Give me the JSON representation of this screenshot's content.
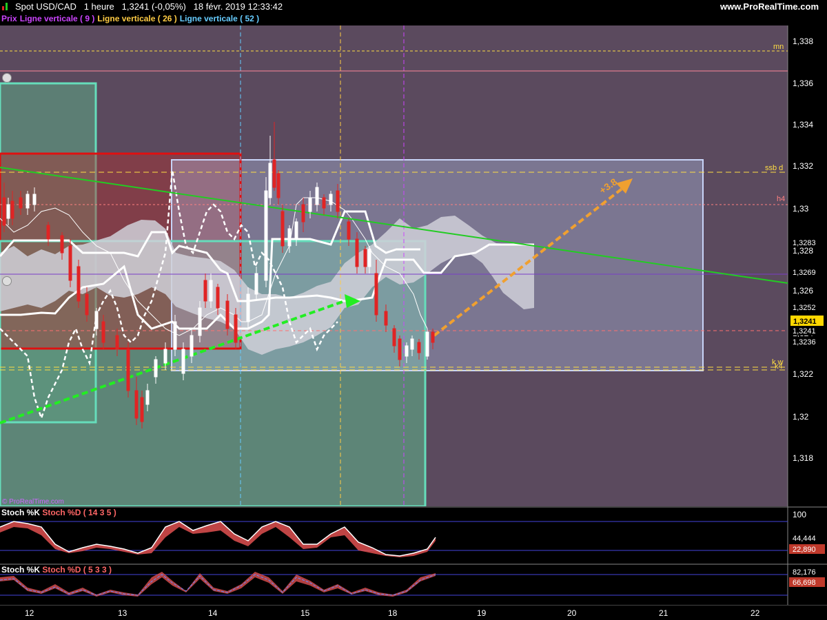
{
  "header": {
    "title": "Spot USD/CAD   1 heure   1,3241 (-0,05%)   18 févr. 2019 12:33:42",
    "site": "www.ProRealTime.com"
  },
  "legend": {
    "prix": "Prix",
    "lv9": "Ligne verticale ( 9 )",
    "lv26": "Ligne verticale ( 26 )",
    "lv52": "Ligne verticale ( 52 )"
  },
  "copyright": "© ProRealTime.com",
  "price_axis": {
    "ticks": [
      "1,338",
      "1,336",
      "1,334",
      "1,332",
      "1,33",
      "1,328",
      "1,326",
      "1,324",
      "1,322",
      "1,32",
      "1,318"
    ],
    "tags": {
      "p1": "1,3283",
      "p2": "1,3269",
      "p3": "1,3252",
      "p4": "1,3241",
      "p5": "1,3241",
      "p6": "1,3236"
    }
  },
  "annotations": {
    "mn": "mn",
    "ssbd": "ssb d",
    "h4": "h4",
    "kw": "k w",
    "k4": "k4",
    "arrow_label": "+3.8"
  },
  "stoch1": {
    "label_k": "Stoch %K",
    "label_d": "Stoch %D ( 14 3 5 )",
    "axis_top": "100",
    "value_k": "44,444",
    "value_d": "22,890"
  },
  "stoch2": {
    "label_k": "Stoch %K",
    "label_d": "Stoch %D ( 5 3 3 )",
    "value_k": "82,176",
    "value_d": "66,698"
  },
  "date_axis": [
    "12",
    "13",
    "14",
    "15",
    "18",
    "19",
    "20",
    "21",
    "22"
  ],
  "colors": {
    "up": "#ffffff",
    "down": "#e02424",
    "bg_main": "#5b4a5e",
    "cloud": "#c8c8d0",
    "trend_green": "#22cc22",
    "arrow_orange": "#f0a030",
    "mint_box": "#66ddbb",
    "red_box": "#e01010",
    "lavender_box": "#b8c8f0"
  }
}
